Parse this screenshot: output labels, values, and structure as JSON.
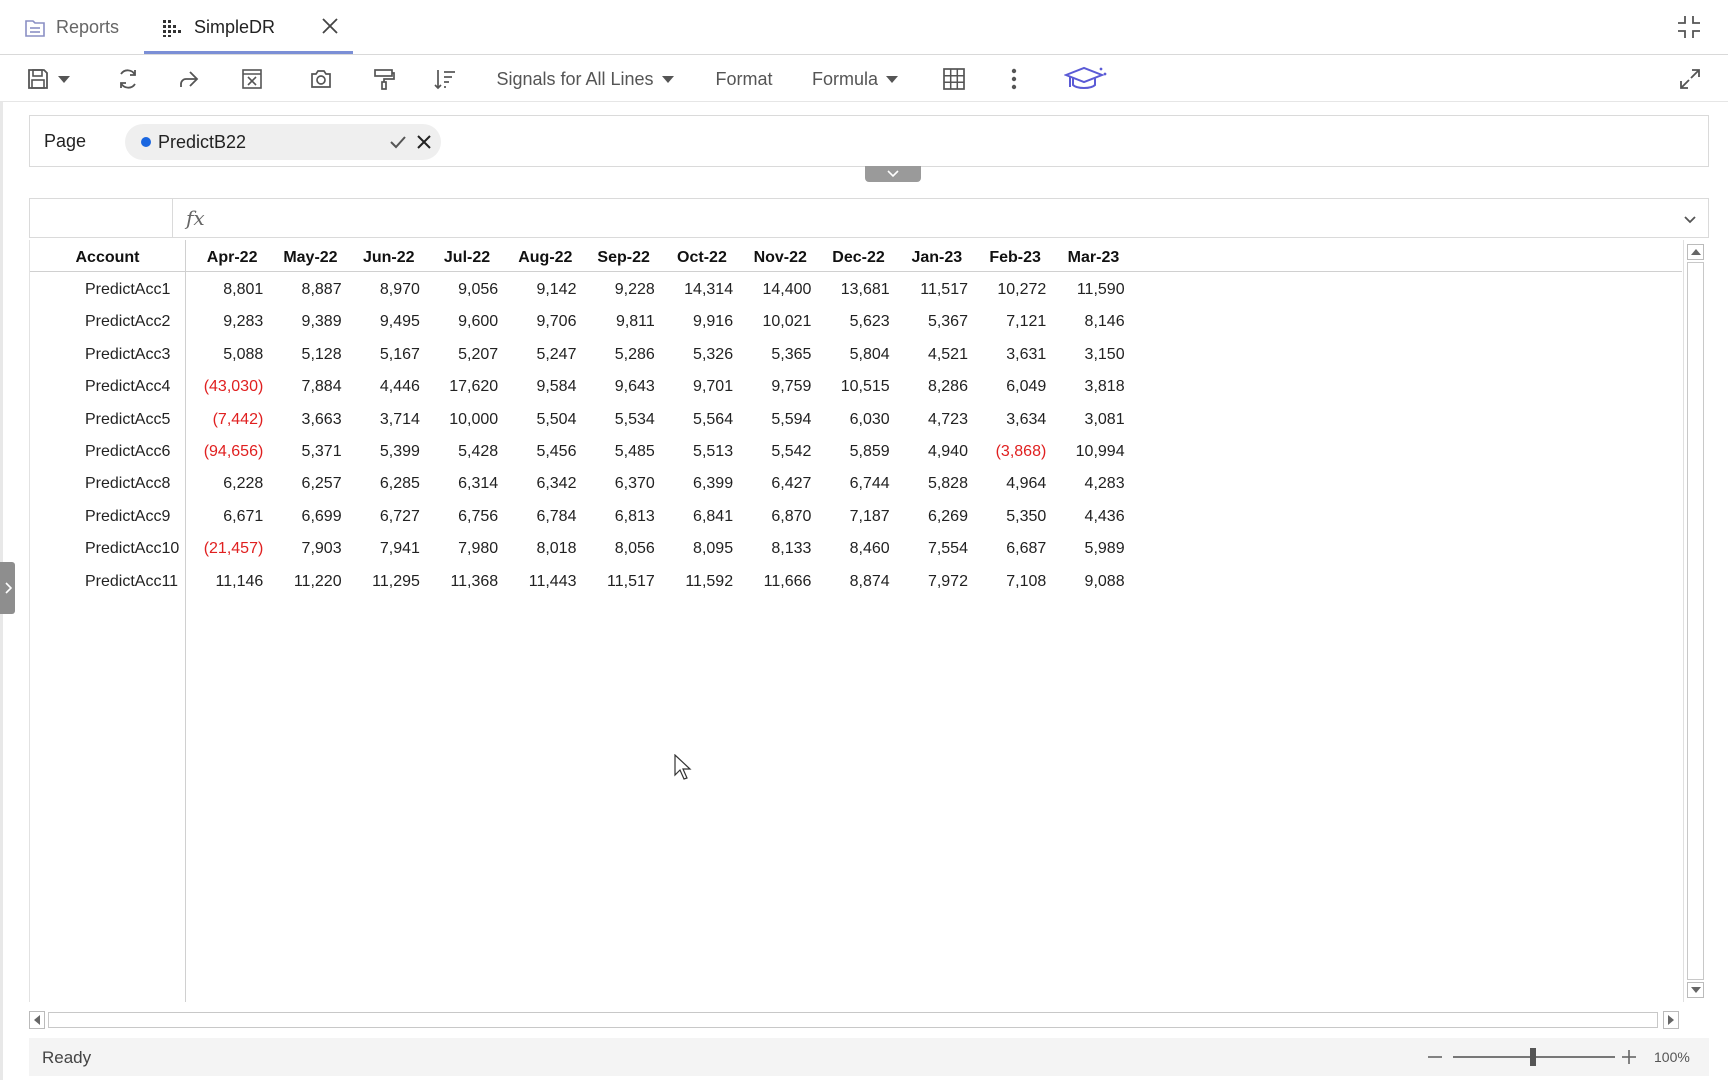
{
  "tabs": {
    "reports_label": "Reports",
    "active_label": "SimpleDR"
  },
  "toolbar": {
    "signals_label": "Signals for All Lines",
    "format_label": "Format",
    "formula_label": "Formula",
    "accent_color": "#5b5bd6"
  },
  "page_filter": {
    "label": "Page",
    "value": "PredictB22",
    "dot_color": "#1a66e0"
  },
  "formula_bar": {
    "fx_label": "fx",
    "value": ""
  },
  "grid": {
    "columns": [
      "Account",
      "Apr-22",
      "May-22",
      "Jun-22",
      "Jul-22",
      "Aug-22",
      "Sep-22",
      "Oct-22",
      "Nov-22",
      "Dec-22",
      "Jan-23",
      "Feb-23",
      "Mar-23"
    ],
    "rows": [
      {
        "account": "PredictAcc1",
        "values": [
          "8,801",
          "8,887",
          "8,970",
          "9,056",
          "9,142",
          "9,228",
          "14,314",
          "14,400",
          "13,681",
          "11,517",
          "10,272",
          "11,590"
        ]
      },
      {
        "account": "PredictAcc2",
        "values": [
          "9,283",
          "9,389",
          "9,495",
          "9,600",
          "9,706",
          "9,811",
          "9,916",
          "10,021",
          "5,623",
          "5,367",
          "7,121",
          "8,146"
        ]
      },
      {
        "account": "PredictAcc3",
        "values": [
          "5,088",
          "5,128",
          "5,167",
          "5,207",
          "5,247",
          "5,286",
          "5,326",
          "5,365",
          "5,804",
          "4,521",
          "3,631",
          "3,150"
        ]
      },
      {
        "account": "PredictAcc4",
        "values": [
          "(43,030)",
          "7,884",
          "4,446",
          "17,620",
          "9,584",
          "9,643",
          "9,701",
          "9,759",
          "10,515",
          "8,286",
          "6,049",
          "3,818"
        ]
      },
      {
        "account": "PredictAcc5",
        "values": [
          "(7,442)",
          "3,663",
          "3,714",
          "10,000",
          "5,504",
          "5,534",
          "5,564",
          "5,594",
          "6,030",
          "4,723",
          "3,634",
          "3,081"
        ]
      },
      {
        "account": "PredictAcc6",
        "values": [
          "(94,656)",
          "5,371",
          "5,399",
          "5,428",
          "5,456",
          "5,485",
          "5,513",
          "5,542",
          "5,859",
          "4,940",
          "(3,868)",
          "10,994"
        ]
      },
      {
        "account": "PredictAcc8",
        "values": [
          "6,228",
          "6,257",
          "6,285",
          "6,314",
          "6,342",
          "6,370",
          "6,399",
          "6,427",
          "6,744",
          "5,828",
          "4,964",
          "4,283"
        ]
      },
      {
        "account": "PredictAcc9",
        "values": [
          "6,671",
          "6,699",
          "6,727",
          "6,756",
          "6,784",
          "6,813",
          "6,841",
          "6,870",
          "7,187",
          "6,269",
          "5,350",
          "4,436"
        ]
      },
      {
        "account": "PredictAcc10",
        "values": [
          "(21,457)",
          "7,903",
          "7,941",
          "7,980",
          "8,018",
          "8,056",
          "8,095",
          "8,133",
          "8,460",
          "7,554",
          "6,687",
          "5,989"
        ]
      },
      {
        "account": "PredictAcc11",
        "values": [
          "11,146",
          "11,220",
          "11,295",
          "11,368",
          "11,443",
          "11,517",
          "11,592",
          "11,666",
          "8,874",
          "7,972",
          "7,108",
          "9,088"
        ]
      }
    ],
    "negative_color": "#e02020"
  },
  "status": {
    "text": "Ready",
    "zoom": "100%"
  }
}
